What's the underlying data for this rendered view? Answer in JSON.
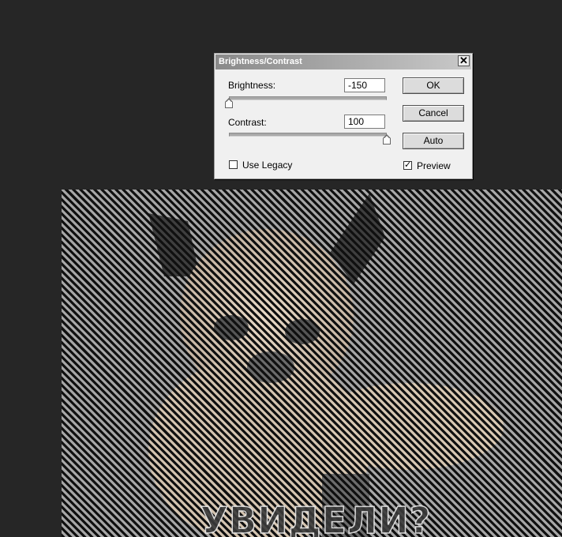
{
  "dialog": {
    "title": "Brightness/Contrast",
    "close_glyph": "✕",
    "brightness": {
      "label": "Brightness:",
      "value": "-150",
      "slider_position": 0.0
    },
    "contrast": {
      "label": "Contrast:",
      "value": "100",
      "slider_position": 1.0
    },
    "use_legacy": {
      "label": "Use Legacy",
      "checked": false
    },
    "preview": {
      "label": "Preview",
      "checked": true,
      "check_glyph": "✓"
    },
    "buttons": {
      "ok": "OK",
      "cancel": "Cancel",
      "auto": "Auto"
    }
  },
  "canvas": {
    "caption": "УВИДЕЛИ?",
    "stripe_color": "#101010"
  }
}
